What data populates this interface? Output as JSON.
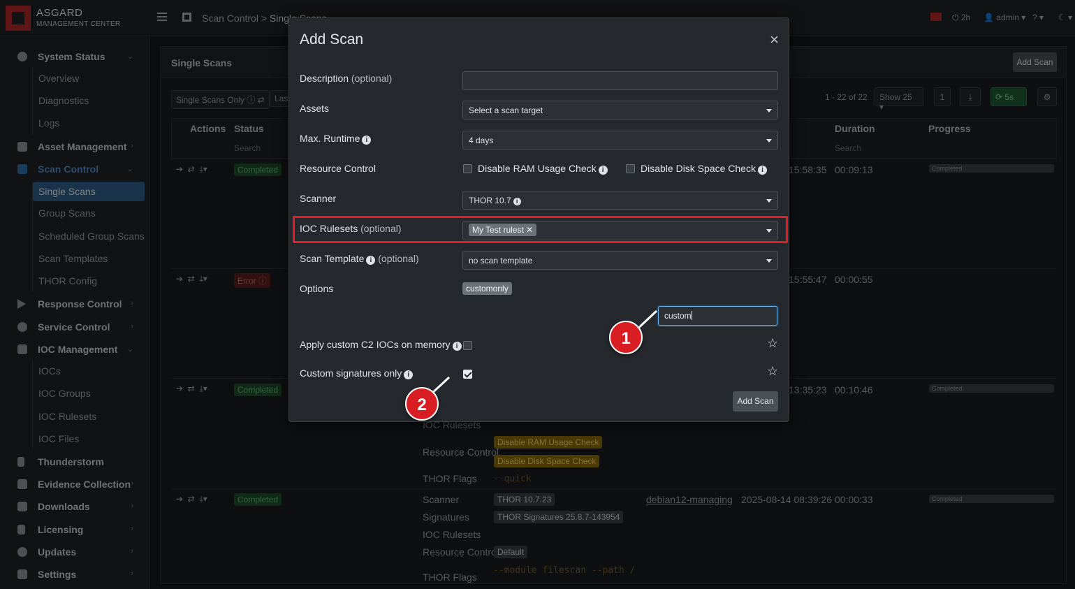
{
  "brand": {
    "name": "ASGARD",
    "sub": "MANAGEMENT CENTER"
  },
  "breadcrumbs": {
    "first": "Scan Control",
    "sep": ">",
    "current": "Single Scans"
  },
  "topbar": {
    "timer": "2h",
    "user": "admin"
  },
  "sidebar": {
    "system_status": "System Status",
    "overview": "Overview",
    "diagnostics": "Diagnostics",
    "logs": "Logs",
    "asset_management": "Asset Management",
    "scan_control": "Scan Control",
    "single_scans": "Single Scans",
    "group_scans": "Group Scans",
    "scheduled_group_scans": "Scheduled Group Scans",
    "scan_templates": "Scan Templates",
    "thor_config": "THOR Config",
    "response_control": "Response Control",
    "service_control": "Service Control",
    "ioc_management": "IOC Management",
    "iocs": "IOCs",
    "ioc_groups": "IOC Groups",
    "ioc_rulesets": "IOC Rulesets",
    "ioc_files": "IOC Files",
    "thunderstorm": "Thunderstorm",
    "evidence_collection": "Evidence Collection",
    "downloads": "Downloads",
    "licensing": "Licensing",
    "updates": "Updates",
    "settings": "Settings"
  },
  "panel": {
    "title": "Single Scans",
    "add_scan": "Add Scan",
    "filter": "Single Scans Only",
    "filter2": "Last",
    "pagination": "1 - 22 of 22",
    "show": "Show 25",
    "page": "1",
    "refresh": "5s",
    "columns": {
      "actions": "Actions",
      "status": "Status",
      "duration": "Duration",
      "progress": "Progress"
    },
    "search_placeholder": "Search"
  },
  "rows": [
    {
      "status": "Completed",
      "time": "15:58:35",
      "duration": "00:09:13",
      "progress": "Completed"
    },
    {
      "status": "Error",
      "time": "15:55:47",
      "duration": "00:00:55"
    },
    {
      "status": "Completed",
      "time": "13:35:23",
      "duration": "00:10:46",
      "progress": "Completed"
    },
    {
      "status": "Completed",
      "time": "2025-08-14 08:39:26",
      "duration": "00:00:33",
      "progress": "Completed",
      "host": "debian12-managing"
    }
  ],
  "row_details": {
    "ioc_rulesets": "IOC Rulesets",
    "resource_control": "Resource Control",
    "ram_badge": "Disable RAM Usage Check",
    "disk_badge": "Disable Disk Space Check",
    "thor_flags": "THOR Flags",
    "flags1": "--quick",
    "scanner": "Scanner",
    "scanner_val": "THOR 10.7.23",
    "signatures": "Signatures",
    "signatures_val": "THOR Signatures 25.8.7-143954",
    "ioc_rulesets2": "IOC Rulesets",
    "resource_control2": "Resource Control",
    "default": "Default",
    "thor_flags2": "THOR Flags",
    "flags2": "--module filescan --path /"
  },
  "modal": {
    "title": "Add Scan",
    "close": "×",
    "description_label": "Description",
    "optional": "(optional)",
    "assets_label": "Assets",
    "assets_value": "Select a scan target",
    "max_runtime_label": "Max. Runtime",
    "max_runtime_value": "4 days",
    "resource_control_label": "Resource Control",
    "disable_ram": "Disable RAM Usage Check",
    "disable_disk": "Disable Disk Space Check",
    "scanner_label": "Scanner",
    "scanner_value": "THOR 10.7",
    "ioc_rulesets_label": "IOC Rulesets",
    "ioc_ruleset_tag": "My Test rulest",
    "scan_template_label": "Scan Template",
    "scan_template_value": "no scan template",
    "options_label": "Options",
    "options_tag": "customonly",
    "options_search": "custom",
    "apply_c2_label": "Apply custom C2 IOCs on memory",
    "custom_sigs_label": "Custom signatures only",
    "submit": "Add Scan"
  },
  "callouts": {
    "one": "1",
    "two": "2"
  },
  "colors": {
    "accent": "#2e5f88",
    "highlight": "#e01e25",
    "callout": "#d81e22"
  }
}
